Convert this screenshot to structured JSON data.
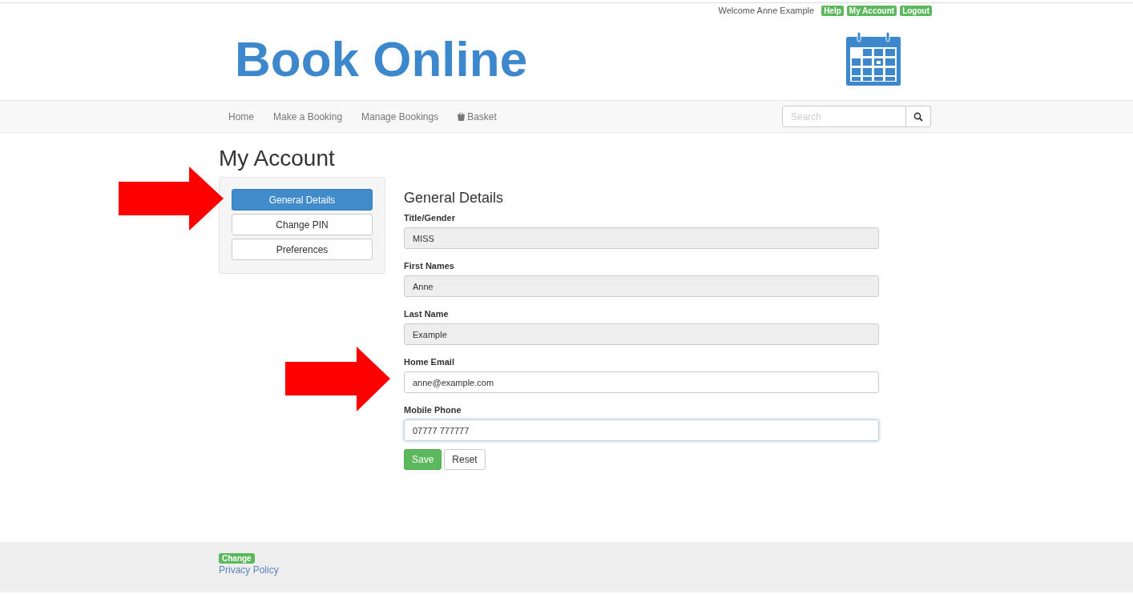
{
  "top_bar": {
    "welcome": "Welcome Anne Example",
    "links": [
      "Help",
      "My Account",
      "Logout"
    ]
  },
  "header": {
    "logo": "Book Online"
  },
  "nav": {
    "items": [
      {
        "label": "Home",
        "icon": false
      },
      {
        "label": "Make a Booking",
        "icon": false
      },
      {
        "label": "Manage Bookings",
        "icon": false
      },
      {
        "label": "Basket",
        "icon": true
      }
    ],
    "search": {
      "placeholder": "Search"
    }
  },
  "page_title": "My Account",
  "side_menu": [
    {
      "label": "General Details",
      "selected": true
    },
    {
      "label": "Change PIN",
      "selected": false
    },
    {
      "label": "Preferences",
      "selected": false
    }
  ],
  "form": {
    "title": "General Details",
    "fields": [
      {
        "label": "Title/Gender",
        "value": "MISS",
        "disabled": true,
        "focused": false
      },
      {
        "label": "First Names",
        "value": "Anne",
        "disabled": true,
        "focused": false
      },
      {
        "label": "Last Name",
        "value": "Example",
        "disabled": true,
        "focused": false
      },
      {
        "label": "Home Email",
        "value": "anne@example.com",
        "disabled": false,
        "focused": false
      },
      {
        "label": "Mobile Phone",
        "value": "07777 777777",
        "disabled": false,
        "focused": true
      }
    ],
    "buttons": [
      {
        "label": "Save",
        "kind": "primary"
      },
      {
        "label": "Reset",
        "kind": "default"
      }
    ]
  },
  "footer": {
    "badge": "Change",
    "link": "Privacy Policy"
  }
}
